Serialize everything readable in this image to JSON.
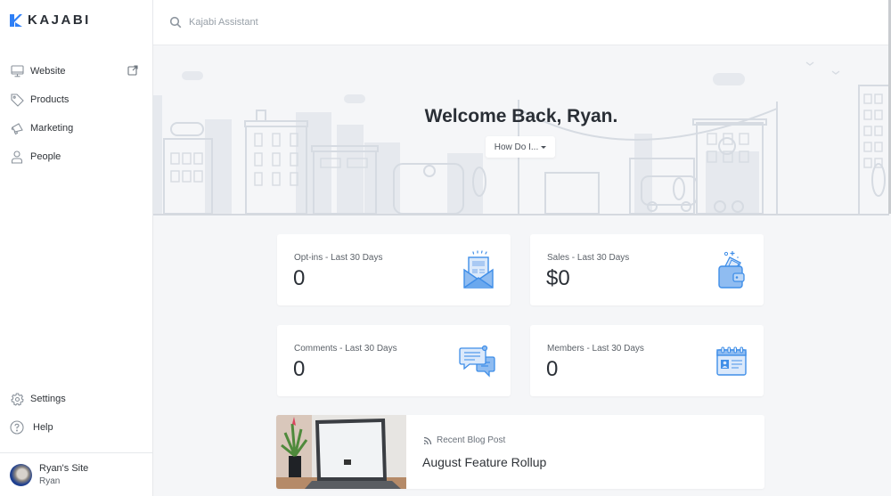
{
  "brand": {
    "name": "KAJABI",
    "accent": "#2e7ff6"
  },
  "sidebar": {
    "items": [
      {
        "label": "Website",
        "icon": "monitor-icon",
        "external": true
      },
      {
        "label": "Products",
        "icon": "tag-icon"
      },
      {
        "label": "Marketing",
        "icon": "megaphone-icon"
      },
      {
        "label": "People",
        "icon": "person-icon"
      }
    ],
    "bottom_items": [
      {
        "label": "Settings",
        "icon": "gear-icon"
      },
      {
        "label": "Help",
        "icon": "question-icon"
      }
    ],
    "user": {
      "site": "Ryan's Site",
      "name": "Ryan"
    }
  },
  "search": {
    "placeholder": "Kajabi Assistant",
    "value": ""
  },
  "hero": {
    "title": "Welcome Back, Ryan.",
    "dropdown_label": "How Do I..."
  },
  "stats": [
    {
      "label": "Opt-ins - Last 30 Days",
      "value": "0",
      "icon": "envelope-newsletter-icon"
    },
    {
      "label": "Sales - Last 30 Days",
      "value": "$0",
      "icon": "wallet-icon"
    },
    {
      "label": "Comments - Last 30 Days",
      "value": "0",
      "icon": "chat-bubbles-icon"
    },
    {
      "label": "Members - Last 30 Days",
      "value": "0",
      "icon": "id-card-icon"
    }
  ],
  "blog": {
    "meta_label": "Recent Blog Post",
    "title": "August Feature Rollup"
  }
}
